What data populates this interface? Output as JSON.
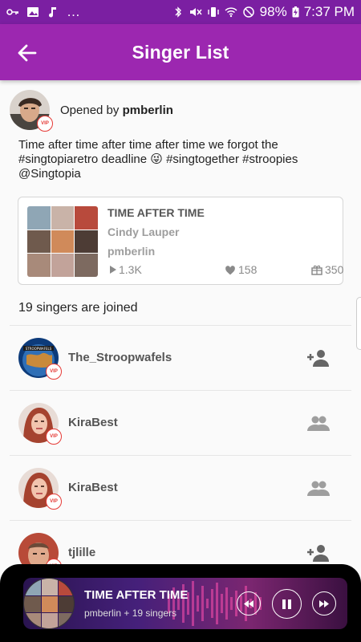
{
  "status_bar": {
    "left_icons": [
      "ellipsis"
    ],
    "battery": "98%",
    "time": "7:37 PM"
  },
  "app_bar": {
    "title": "Singer List",
    "back_icon": "arrow-back-icon"
  },
  "opener": {
    "prefix": "Opened by",
    "username": "pmberlin",
    "badge": "VIP"
  },
  "post": {
    "text": "Time after time after time after time we forgot the #singtopiaretro deadline 😜 #singtogether #stroopies @Singtopia"
  },
  "song_card": {
    "title": "TIME AFTER TIME",
    "artist": "Cindy Lauper",
    "owner": "pmberlin",
    "plays": "1.3K",
    "likes": "158",
    "gifts": "350"
  },
  "joined_text": "19 singers are joined",
  "singers": [
    {
      "name": "The_Stroopwafels",
      "badge": "VIP",
      "action": "add-person-icon"
    },
    {
      "name": "KiraBest",
      "badge": "VIP",
      "action": "people-icon"
    },
    {
      "name": "KiraBest",
      "badge": "VIP",
      "action": "people-icon"
    },
    {
      "name": "tjlille",
      "badge": "VIP",
      "action": "add-person-icon"
    }
  ],
  "player": {
    "title": "TIME AFTER TIME",
    "subtitle": "pmberlin + 19 singers",
    "controls": [
      "rewind-icon",
      "pause-icon",
      "fast-forward-icon"
    ]
  },
  "colors": {
    "status_bar": "#7b1fa2",
    "app_bar": "#9c27b0",
    "vip_red": "#e53935",
    "player_bg": "#000000"
  }
}
